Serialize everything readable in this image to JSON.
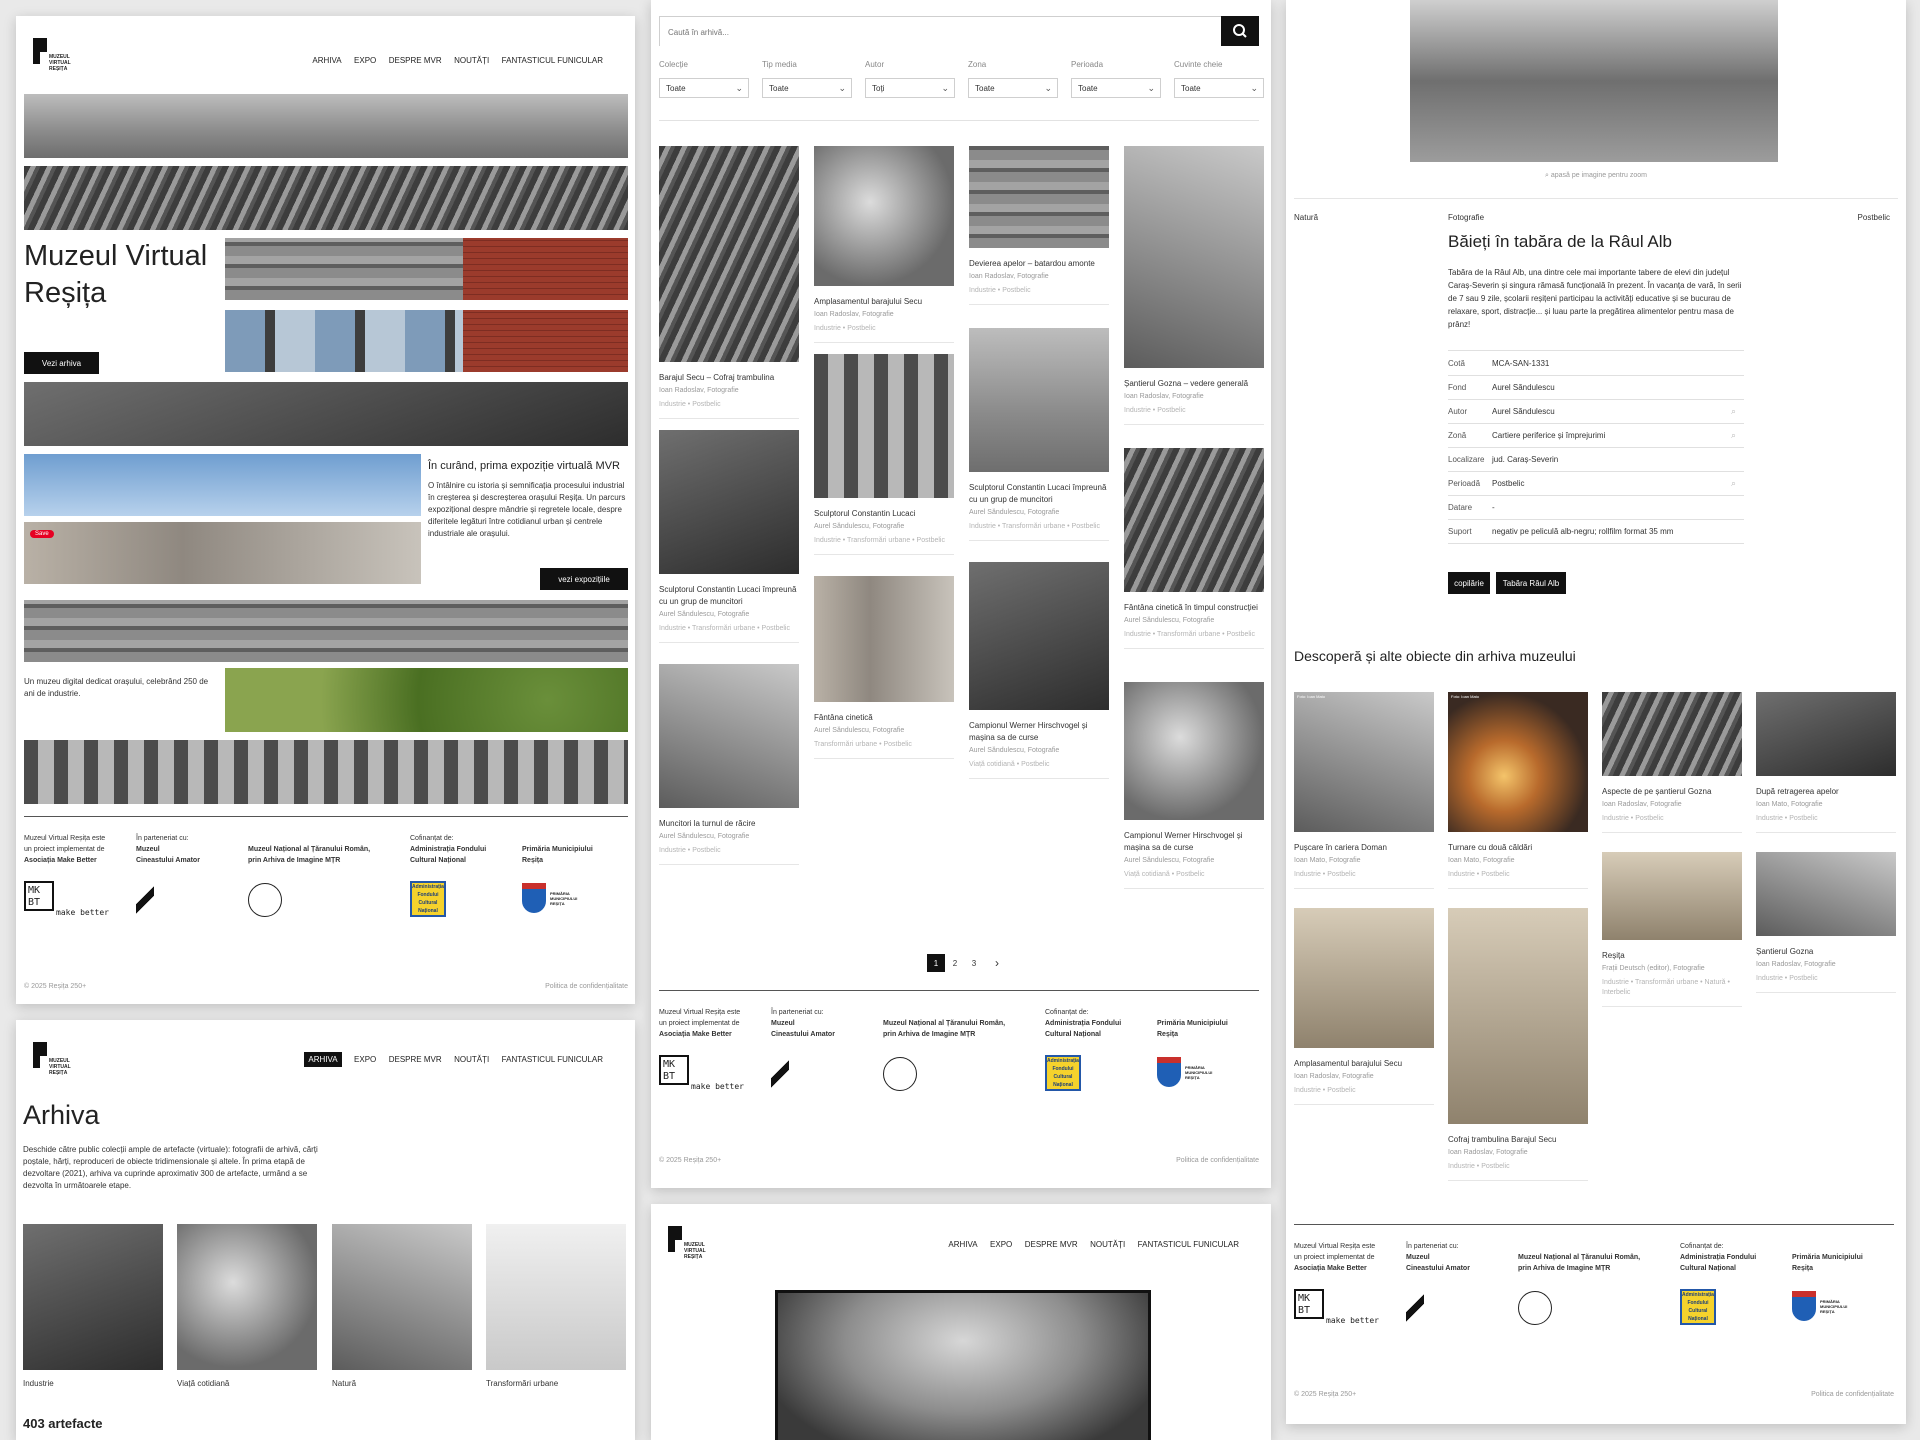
{
  "brand": {
    "logo_text": [
      "MUZEUL",
      "VIRTUAL",
      "REȘIȚA"
    ]
  },
  "nav": {
    "items": [
      "ARHIVA",
      "EXPO",
      "DESPRE MVR",
      "NOUTĂȚI",
      "FANTASTICUL FUNICULAR"
    ]
  },
  "home": {
    "title_line1": "Muzeul Virtual",
    "title_line2": "Reșița",
    "cta": "Vezi arhiva",
    "expo_title": "În curând, prima expoziție virtuală MVR",
    "expo_text": "O întâlnire cu istoria și semnificația procesului industrial în creșterea și descreșterea orașului Reșița. Un parcurs expozițional despre mândrie și regretele locale, despre diferitele legături între cotidianul urban și centrele industriale ale orașului.",
    "expo_button": "vezi expozițiile",
    "save_badge": "Save",
    "tagline": "Un muzeu digital dedicat orașului, celebrând 250 de ani de industrie."
  },
  "footer": {
    "c1_l1": "Muzeul Virtual Reșița este",
    "c1_l2": "un proiect implementat de",
    "c1_l3": "Asociația Make Better",
    "c2_l1": "În parteneriat cu:",
    "c2_l2": "Muzeul",
    "c2_l3": "Cineastului Amator",
    "c3_l1": "Muzeul Național al Țăranului Român,",
    "c3_l2": "prin Arhiva de Imagine MȚR",
    "c4_l1": "Cofinanțat de:",
    "c4_l2": "Administrația Fondului",
    "c4_l3": "Cultural Național",
    "c5_l1": "Primăria Municipiului",
    "c5_l2": "Reșița",
    "mkbt": [
      "MK",
      "BT",
      "make  better"
    ],
    "afcn": [
      "Administrația",
      "Fondului",
      "Cultural",
      "Național"
    ],
    "primaria": [
      "PRIMĂRIA",
      "MUNICIPIULUI",
      "REȘIȚA"
    ],
    "copyright": "© 2025 Reșița 250+",
    "privacy": "Politica de confidențialitate"
  },
  "arhiva": {
    "title": "Arhiva",
    "desc": "Deschide către public colecții ample de artefacte (virtuale): fotografii de arhivă, cărți poștale, hărți, reproduceri de obiecte tridimensionale și altele. În prima etapă de dezvoltare (2021), arhiva va cuprinde aproximativ 300 de artefacte, urmând a se dezvolta în următoarele etape.",
    "categories": [
      "Industrie",
      "Viață cotidiană",
      "Natură",
      "Transformări urbane"
    ],
    "count": "403 artefacte"
  },
  "search": {
    "placeholder": "Caută în arhivă...",
    "filters": [
      {
        "label": "Colecție",
        "value": "Toate"
      },
      {
        "label": "Tip media",
        "value": "Toate"
      },
      {
        "label": "Autor",
        "value": "Toți"
      },
      {
        "label": "Zona",
        "value": "Toate"
      },
      {
        "label": "Perioada",
        "value": "Toate"
      },
      {
        "label": "Cuvinte cheie",
        "value": "Toate"
      }
    ]
  },
  "results": [
    {
      "title": "Barajul Secu – Cofraj trambulina",
      "author": "Ioan Radoslav, Fotografie",
      "tags": "Industrie • Postbelic"
    },
    {
      "title": "Sculptorul Constantin Lucaci împreună cu un grup de muncitori",
      "author": "Aurel Săndulescu, Fotografie",
      "tags": "Industrie • Transformări urbane • Postbelic"
    },
    {
      "title": "Muncitori la turnul de răcire",
      "author": "Aurel Săndulescu, Fotografie",
      "tags": "Industrie • Postbelic"
    },
    {
      "title": "Amplasamentul barajului Secu",
      "author": "Ioan Radoslav, Fotografie",
      "tags": "Industrie • Postbelic"
    },
    {
      "title": "Sculptorul Constantin Lucaci",
      "author": "Aurel Săndulescu, Fotografie",
      "tags": "Industrie • Transformări urbane • Postbelic"
    },
    {
      "title": "Fântâna cinetică",
      "author": "Aurel Săndulescu, Fotografie",
      "tags": "Transformări urbane • Postbelic"
    },
    {
      "title": "Devierea apelor – batardou amonte",
      "author": "Ioan Radoslav, Fotografie",
      "tags": "Industrie • Postbelic"
    },
    {
      "title": "Sculptorul Constantin Lucaci împreună cu un grup de muncitori",
      "author": "Aurel Săndulescu, Fotografie",
      "tags": "Industrie • Transformări urbane • Postbelic"
    },
    {
      "title": "Campionul Werner Hirschvogel și mașina sa de curse",
      "author": "Aurel Săndulescu, Fotografie",
      "tags": "Viață cotidiană • Postbelic"
    },
    {
      "title": "Șantierul Gozna – vedere generală",
      "author": "Ioan Radoslav, Fotografie",
      "tags": "Industrie • Postbelic"
    },
    {
      "title": "Fântâna cinetică în timpul construcției",
      "author": "Aurel Săndulescu, Fotografie",
      "tags": "Industrie • Transformări urbane • Postbelic"
    },
    {
      "title": "Campionul Werner Hirschvogel și mașina sa de curse",
      "author": "Aurel Săndulescu, Fotografie",
      "tags": "Viață cotidiană • Postbelic"
    }
  ],
  "pagination": {
    "pages": [
      "1",
      "2",
      "3"
    ],
    "next": "›"
  },
  "detail": {
    "zoom_hint": "apasă pe imagine pentru zoom",
    "left_tag": "Natură",
    "type": "Fotografie",
    "right_tag": "Postbelic",
    "title": "Băieți în tabăra de la Râul Alb",
    "desc": "Tabăra de la Râul Alb, una dintre cele mai importante tabere de elevi din județul Caraș-Severin și singura rămasă funcțională în prezent. În vacanța de vară, în serii de 7 sau 9 zile, școlarii reșițeni participau la activități educative și se bucurau de relaxare, sport, distracție... și luau parte la pregătirea alimentelor pentru masa de prânz!",
    "rows": [
      {
        "k": "Cotă",
        "v": "MCA-SAN-1331"
      },
      {
        "k": "Fond",
        "v": "Aurel Săndulescu"
      },
      {
        "k": "Autor",
        "v": "Aurel Săndulescu"
      },
      {
        "k": "Zonă",
        "v": "Cartiere periferice și împrejurimi"
      },
      {
        "k": "Localizare",
        "v": "jud. Caraș-Severin"
      },
      {
        "k": "Perioadă",
        "v": "Postbelic"
      },
      {
        "k": "Datare",
        "v": "-"
      },
      {
        "k": "Suport",
        "v": "negativ pe peliculă alb-negru; rollfilm format 35 mm"
      }
    ],
    "btn1": "copilărie",
    "btn2": "Tabăra Râul Alb",
    "discover": "Descoperă și alte obiecte din arhiva muzeului"
  },
  "related": [
    {
      "title": "Pușcare în cariera Doman",
      "author": "Ioan Mato, Fotografie",
      "tags": "Industrie • Postbelic",
      "cap": "Foto: Ioan Mato"
    },
    {
      "title": "Amplasamentul barajului Secu",
      "author": "Ioan Radoslav, Fotografie",
      "tags": "Industrie • Postbelic"
    },
    {
      "title": "Turnare cu două căldări",
      "author": "Ioan Mato, Fotografie",
      "tags": "Industrie • Postbelic",
      "cap": "Foto: Ioan Mato"
    },
    {
      "title": "Cofraj trambulina Barajul Secu",
      "author": "Ioan Radoslav, Fotografie",
      "tags": "Industrie • Postbelic"
    },
    {
      "title": "Aspecte de pe șantierul Gozna",
      "author": "Ioan Radoslav, Fotografie",
      "tags": "Industrie • Postbelic"
    },
    {
      "title": "Reșița",
      "author": "Frații Deutsch (editor), Fotografie",
      "tags": "Industrie • Transformări urbane • Natură • Interbelic"
    },
    {
      "title": "După retragerea apelor",
      "author": "Ioan Mato, Fotografie",
      "tags": "Industrie • Postbelic"
    },
    {
      "title": "Șantierul Gozna",
      "author": "Ioan Radoslav, Fotografie",
      "tags": "Industrie • Postbelic"
    }
  ]
}
